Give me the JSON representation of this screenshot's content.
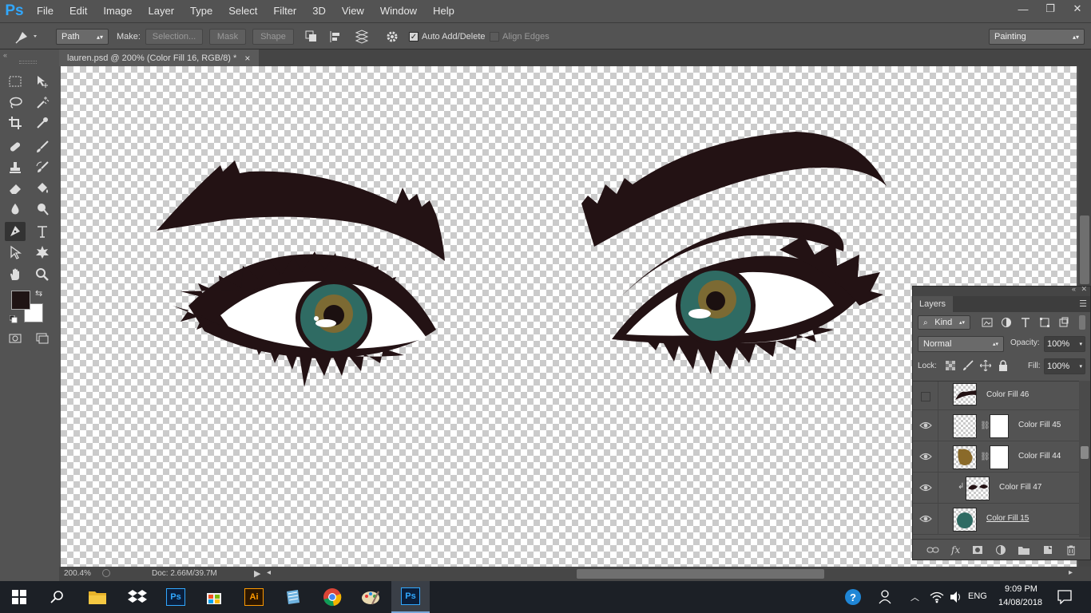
{
  "app": {
    "logo": "Ps"
  },
  "menu": [
    "File",
    "Edit",
    "Image",
    "Layer",
    "Type",
    "Select",
    "Filter",
    "3D",
    "View",
    "Window",
    "Help"
  ],
  "window_controls": {
    "minimize": "—",
    "restore": "❐",
    "close": "✕"
  },
  "options": {
    "mode_select": "Path",
    "make_label": "Make:",
    "selection_btn": "Selection...",
    "mask_btn": "Mask",
    "shape_btn": "Shape",
    "auto_add_delete": {
      "label": "Auto Add/Delete",
      "checked": true
    },
    "align_edges": {
      "label": "Align Edges",
      "checked": false
    },
    "workspace": "Painting"
  },
  "document": {
    "tab_title": "lauren.psd @ 200% (Color Fill 16, RGB/8) *",
    "close_glyph": "×"
  },
  "status": {
    "zoom": "200.4%",
    "doc_size": "Doc: 2.66M/39.7M"
  },
  "layers_panel": {
    "tab": "Layers",
    "filter_kind": "Kind",
    "blend_mode": "Normal",
    "opacity_label": "Opacity:",
    "opacity_value": "100%",
    "lock_label": "Lock:",
    "fill_label": "Fill:",
    "fill_value": "100%",
    "layers": [
      {
        "name": "Color Fill 46",
        "visible": false,
        "has_mask": false,
        "clipped": false,
        "thumb": "black-brow"
      },
      {
        "name": "Color Fill 45",
        "visible": true,
        "has_mask": true,
        "clipped": false,
        "thumb": "transparent"
      },
      {
        "name": "Color Fill 44",
        "visible": true,
        "has_mask": true,
        "clipped": false,
        "thumb": "brown"
      },
      {
        "name": "Color Fill 47",
        "visible": true,
        "has_mask": false,
        "clipped": true,
        "thumb": "eyes"
      },
      {
        "name": "Color Fill 15",
        "visible": true,
        "has_mask": false,
        "clipped": false,
        "thumb": "teal"
      }
    ]
  },
  "taskbar": {
    "time": "9:09 PM",
    "date": "14/08/2018",
    "language": "ENG",
    "apps": [
      "start",
      "search",
      "file-explorer",
      "dropbox",
      "photoshop",
      "store",
      "illustrator",
      "notepad",
      "chrome",
      "paint",
      "photoshop-active"
    ]
  },
  "colors": {
    "foreground": "#1f1414",
    "background": "#ffffff",
    "brow": "#231214",
    "iris": "#2f6b63",
    "iris_center": "#8a6a2a"
  }
}
